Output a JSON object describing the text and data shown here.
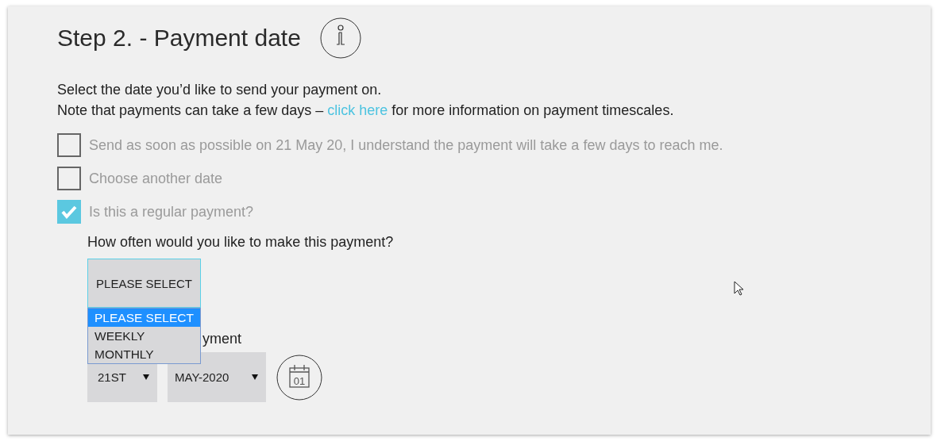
{
  "title": "Step 2. - Payment date",
  "intro": [
    "Select the date you’d like to send your payment on."
  ],
  "note": {
    "before": "Note that payments can take a few days – ",
    "link": "click here",
    "after": " for more information on payment timescales."
  },
  "options": [
    {
      "label": "Send as soon as possible on 21 May 20, I understand the payment will take a few days to reach me.",
      "checked": false
    },
    {
      "label": "Choose another date",
      "checked": false
    },
    {
      "label": "Is this a regular payment?",
      "checked": true
    }
  ],
  "frequency": {
    "question": "How often would you like to make this payment?",
    "value": "PLEASE SELECT",
    "expanded": true,
    "choices": [
      {
        "label": "PLEASE SELECT",
        "selected": true
      },
      {
        "label": "WEEKLY",
        "selected": false
      },
      {
        "label": "MONTHLY",
        "selected": false
      }
    ]
  },
  "first_payment": {
    "label": "yment",
    "day": "21ST",
    "month": "MAY-2020",
    "calendar_icon_text": "01"
  }
}
